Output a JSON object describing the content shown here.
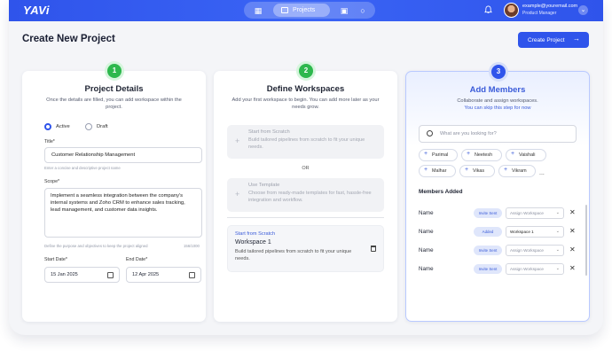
{
  "app": {
    "logo": "YAVi"
  },
  "nav": {
    "active_label": "Projects"
  },
  "user": {
    "email": "example@youremail.com",
    "role": "Product Manager"
  },
  "page": {
    "title": "Create New Project",
    "create_button": "Create Project"
  },
  "steps": [
    {
      "number": "1",
      "title": "Project Details",
      "desc": "Once the details are filled, you can add workspace within the project."
    },
    {
      "number": "2",
      "title": "Define Workspaces",
      "desc": "Add your first workspace to begin. You can add more later as your needs grow."
    },
    {
      "number": "3",
      "title": "Add Members",
      "desc": "Collaborate and assign workspaces.",
      "skip": "You can skip this step for now"
    }
  ],
  "details": {
    "status_options": [
      "Active",
      "Draft"
    ],
    "title_label": "Title*",
    "title_value": "Customer Relationship Management",
    "title_hint": "Enter a concise and descriptive project name",
    "scope_label": "Scope*",
    "scope_value": "Implement a seamless integration between the company's internal systems and Zoho CRM to enhance sales tracking, lead management, and customer data insights.",
    "scope_hint": "Define the purpose and objectives to keep the project aligned",
    "scope_count": "156/1000",
    "start_label": "Start Date*",
    "start_value": "15 Jan 2025",
    "end_label": "End Date*",
    "end_value": "12 Apr 2025"
  },
  "workspaces": {
    "option_scratch_title": "Start from Scratch",
    "option_scratch_desc": "Build tailored pipelines from scratch to fit your unique needs.",
    "or_text": "OR",
    "option_template_title": "Use Template",
    "option_template_desc": "Choose from ready-made templates for fast, hassle-free integration and workflow.",
    "created": {
      "source": "Start from Scratch",
      "name": "Workspace 1",
      "desc": "Build tailored pipelines from scratch to fit your unique needs."
    }
  },
  "members": {
    "search_placeholder": "What are you looking for?",
    "suggestions": [
      "Parimal",
      "Neetesh",
      "Vaishali",
      "Malhar",
      "Vikas",
      "Vikram"
    ],
    "more": "...",
    "added_title": "Members Added",
    "rows": [
      {
        "name": "Name",
        "status": "Invite Sent",
        "workspace": "Assign Workspace"
      },
      {
        "name": "Name",
        "status": "Added",
        "workspace": "Workspace 1"
      },
      {
        "name": "Name",
        "status": "Invite Sent",
        "workspace": "Assign Workspace"
      },
      {
        "name": "Name",
        "status": "Invite Sent",
        "workspace": "Assign Workspace"
      }
    ]
  },
  "icons": {
    "bell": "bell-icon",
    "calendar": "calendar-icon",
    "trash": "trash-icon",
    "search": "search-icon",
    "close": "close-icon",
    "plus": "plus-icon"
  },
  "colors": {
    "primary": "#2f54eb",
    "step_done": "#2db84d"
  }
}
